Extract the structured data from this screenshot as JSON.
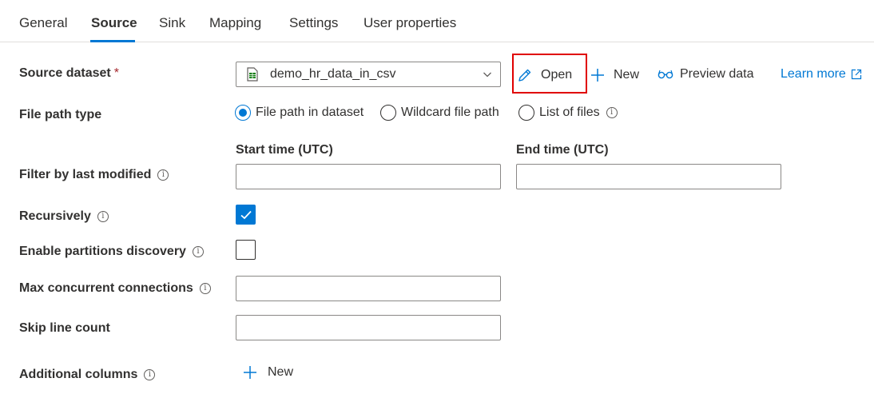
{
  "tabs": [
    {
      "label": "General"
    },
    {
      "label": "Source"
    },
    {
      "label": "Sink"
    },
    {
      "label": "Mapping"
    },
    {
      "label": "Settings"
    },
    {
      "label": "User properties"
    }
  ],
  "active_tab": "Source",
  "source_dataset": {
    "label": "Source dataset",
    "required_mark": "*",
    "selected_value": "demo_hr_data_in_csv",
    "icon": "csv-dataset-icon"
  },
  "actions": {
    "open_label": "Open",
    "new_label": "New",
    "preview_label": "Preview data",
    "learn_more_label": "Learn more"
  },
  "file_path_type": {
    "label": "File path type",
    "options": [
      {
        "label": "File path in dataset",
        "checked": true
      },
      {
        "label": "Wildcard file path",
        "checked": false
      },
      {
        "label": "List of files",
        "checked": false
      }
    ]
  },
  "filter_last_modified": {
    "label": "Filter by last modified",
    "start_label": "Start time (UTC)",
    "end_label": "End time (UTC)",
    "start_value": "",
    "end_value": ""
  },
  "recursively": {
    "label": "Recursively",
    "checked": true
  },
  "partitions": {
    "label": "Enable partitions discovery",
    "checked": false
  },
  "max_connections": {
    "label": "Max concurrent connections",
    "value": ""
  },
  "skip_line_count": {
    "label": "Skip line count",
    "value": ""
  },
  "additional_columns": {
    "label": "Additional columns",
    "new_label": "New"
  },
  "colors": {
    "accent": "#0078d4",
    "highlight": "#e00000",
    "text": "#323130",
    "border": "#8a8886"
  }
}
